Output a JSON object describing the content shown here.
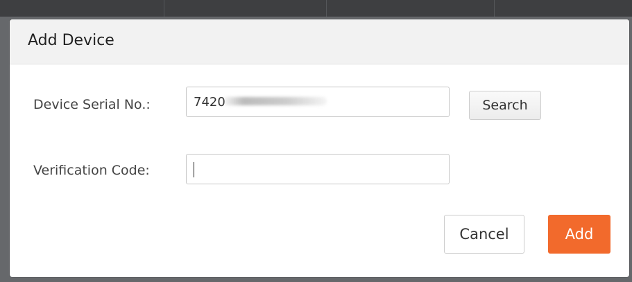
{
  "dialog": {
    "title": "Add Device"
  },
  "form": {
    "serial_label": "Device Serial No.:",
    "serial_value": "7420",
    "verification_label": "Verification Code:",
    "verification_value": ""
  },
  "buttons": {
    "search_label": "Search",
    "cancel_label": "Cancel",
    "add_label": "Add"
  },
  "colors": {
    "add_button": "#f26a2c",
    "header_background": "#f2f2f2",
    "backdrop": "#66686b"
  },
  "icons": {
    "text_cursor": "text-cursor-icon"
  }
}
